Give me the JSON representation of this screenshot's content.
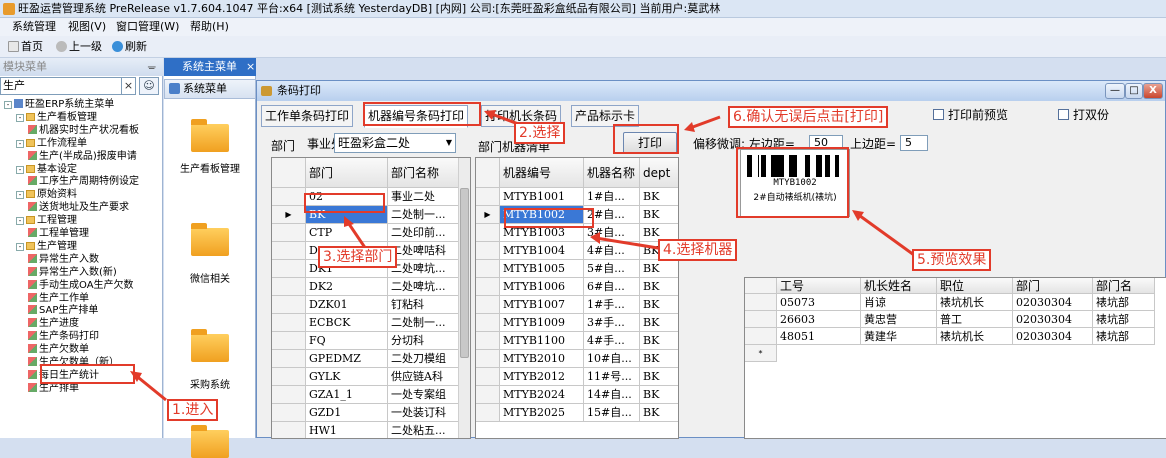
{
  "window": {
    "title": "旺盈运营管理系统 PreRelease v1.7.604.1047 平台:x64  [测试系统 YesterdayDB] [内网] 公司:[东莞旺盈彩盒纸品有限公司] 当前用户:莫武林"
  },
  "menubar": [
    "系统管理",
    "视图(V)",
    "窗口管理(W)",
    "帮助(H)"
  ],
  "toolbar": {
    "home": "首页",
    "back": "上一级",
    "refresh": "刷新"
  },
  "left_panel": {
    "header": "模块菜单",
    "search_value": "生产",
    "clear": "×",
    "tree": [
      {
        "label": "旺盈ERP系统主菜单",
        "level": 0,
        "type": "root",
        "toggle": "-"
      },
      {
        "label": "生产看板管理",
        "level": 1,
        "type": "folder",
        "toggle": "-"
      },
      {
        "label": "机器实时生产状况看板",
        "level": 2,
        "type": "leaf"
      },
      {
        "label": "工作流程单",
        "level": 1,
        "type": "folder",
        "toggle": "-"
      },
      {
        "label": "生产(半成品)报废申请",
        "level": 2,
        "type": "leaf"
      },
      {
        "label": "基本设定",
        "level": 1,
        "type": "folder",
        "toggle": "-"
      },
      {
        "label": "工序生产周期特例设定",
        "level": 2,
        "type": "leaf"
      },
      {
        "label": "原始资料",
        "level": 1,
        "type": "folder",
        "toggle": "-"
      },
      {
        "label": "送货地址及生产要求",
        "level": 2,
        "type": "leaf"
      },
      {
        "label": "工程管理",
        "level": 1,
        "type": "folder",
        "toggle": "-"
      },
      {
        "label": "工程单管理",
        "level": 2,
        "type": "leaf"
      },
      {
        "label": "生产管理",
        "level": 1,
        "type": "folder",
        "toggle": "-"
      },
      {
        "label": "异常生产入数",
        "level": 2,
        "type": "leaf"
      },
      {
        "label": "异常生产入数(新)",
        "level": 2,
        "type": "leaf"
      },
      {
        "label": "手动生成OA生产欠数",
        "level": 2,
        "type": "leaf"
      },
      {
        "label": "生产工作单",
        "level": 2,
        "type": "leaf"
      },
      {
        "label": "SAP生产排单",
        "level": 2,
        "type": "leaf"
      },
      {
        "label": "生产进度",
        "level": 2,
        "type": "leaf"
      },
      {
        "label": "生产条码打印",
        "level": 2,
        "type": "leaf"
      },
      {
        "label": "生产欠数单",
        "level": 2,
        "type": "leaf"
      },
      {
        "label": "生产欠数单（新）",
        "level": 2,
        "type": "leaf"
      },
      {
        "label": "每日生产统计",
        "level": 2,
        "type": "leaf"
      },
      {
        "label": "生产排单",
        "level": 2,
        "type": "leaf"
      }
    ]
  },
  "mid_panel": {
    "tab": "系统主菜单",
    "tab_close": "×",
    "header": "系统菜单",
    "items": [
      "生产看板管理",
      "微信相关",
      "采购系统",
      ""
    ]
  },
  "dialog": {
    "title": "条码打印",
    "min": "—",
    "max": "□",
    "close": "X",
    "tabs": [
      "工作单条码打印",
      "机器编号条码打印",
      "打印机长条码",
      "产品标示卡"
    ],
    "active_tab": 1,
    "dept_label": "部门",
    "division_label": "事业处:",
    "division_value": "旺盈彩盒二处",
    "print_button": "打印",
    "offset_label": "偏移微调: 左边距=",
    "left_margin": "50",
    "top_label": "上边距=",
    "top_margin": "5",
    "preview_before_print_label": "打印前预览",
    "print_duplex_label": "打双份",
    "dept_machine_list_label": "部门机器清单"
  },
  "dept_grid": {
    "columns": [
      "部门",
      "部门名称"
    ],
    "rows": [
      [
        "02",
        "事业二处"
      ],
      [
        "BK",
        "二处制一..."
      ],
      [
        "CTP",
        "二处印前..."
      ],
      [
        "DZ",
        "二处啤咭科"
      ],
      [
        "DK1",
        "二处啤坑..."
      ],
      [
        "DK2",
        "二处啤坑..."
      ],
      [
        "DZK01",
        "钉粘科"
      ],
      [
        "ECBCK",
        "二处制一..."
      ],
      [
        "FQ",
        "分切科"
      ],
      [
        "GPEDMZ",
        "二处刀模组"
      ],
      [
        "GYLK",
        "供应链A科"
      ],
      [
        "GZA1_1",
        "一处专案组"
      ],
      [
        "GZD1",
        "一处装订科"
      ],
      [
        "HW1",
        "二处粘五..."
      ]
    ],
    "selected_row": 1
  },
  "machine_grid": {
    "columns": [
      "机器编号",
      "机器名称",
      "dept"
    ],
    "rows": [
      [
        "MTYB1001",
        "1#自...",
        "BK"
      ],
      [
        "MTYB1002",
        "2#自...",
        "BK"
      ],
      [
        "MTYB1003",
        "3#自...",
        "BK"
      ],
      [
        "MTYB1004",
        "4#自...",
        "BK"
      ],
      [
        "MTYB1005",
        "5#自...",
        "BK"
      ],
      [
        "MTYB1006",
        "6#自...",
        "BK"
      ],
      [
        "MTYB1007",
        "1#手...",
        "BK"
      ],
      [
        "MTYB1009",
        "3#手...",
        "BK"
      ],
      [
        "MTYB1100",
        "4#手...",
        "BK"
      ],
      [
        "MTYB2010",
        "10#自...",
        "BK"
      ],
      [
        "MTYB2012",
        "11#号...",
        "BK"
      ],
      [
        "MTYB2024",
        "14#自...",
        "BK"
      ],
      [
        "MTYB2025",
        "15#自...",
        "BK"
      ]
    ],
    "selected_row": 1
  },
  "barcode_preview": {
    "code": "MTYB1002",
    "name": "2#自动裱纸机(裱坑)"
  },
  "leader_grid": {
    "columns": [
      "工号",
      "机长姓名",
      "职位",
      "部门",
      "部门名"
    ],
    "rows": [
      [
        "05073",
        "肖谅",
        "裱坑机长",
        "02030304",
        "裱坑部"
      ],
      [
        "26603",
        "黄忠营",
        "普工",
        "02030304",
        "裱坑部"
      ],
      [
        "48051",
        "黄建华",
        "裱坑机长",
        "02030304",
        "裱坑部"
      ]
    ],
    "new_row_marker": "*"
  },
  "annotations": {
    "step1": "1.进入",
    "step2": "2.选择",
    "step3": "3.选择部门",
    "step4": "4.选择机器",
    "step5": "5.预览效果",
    "step6": "6.确认无误后点击[打印]",
    "color": "#e23b2a"
  }
}
